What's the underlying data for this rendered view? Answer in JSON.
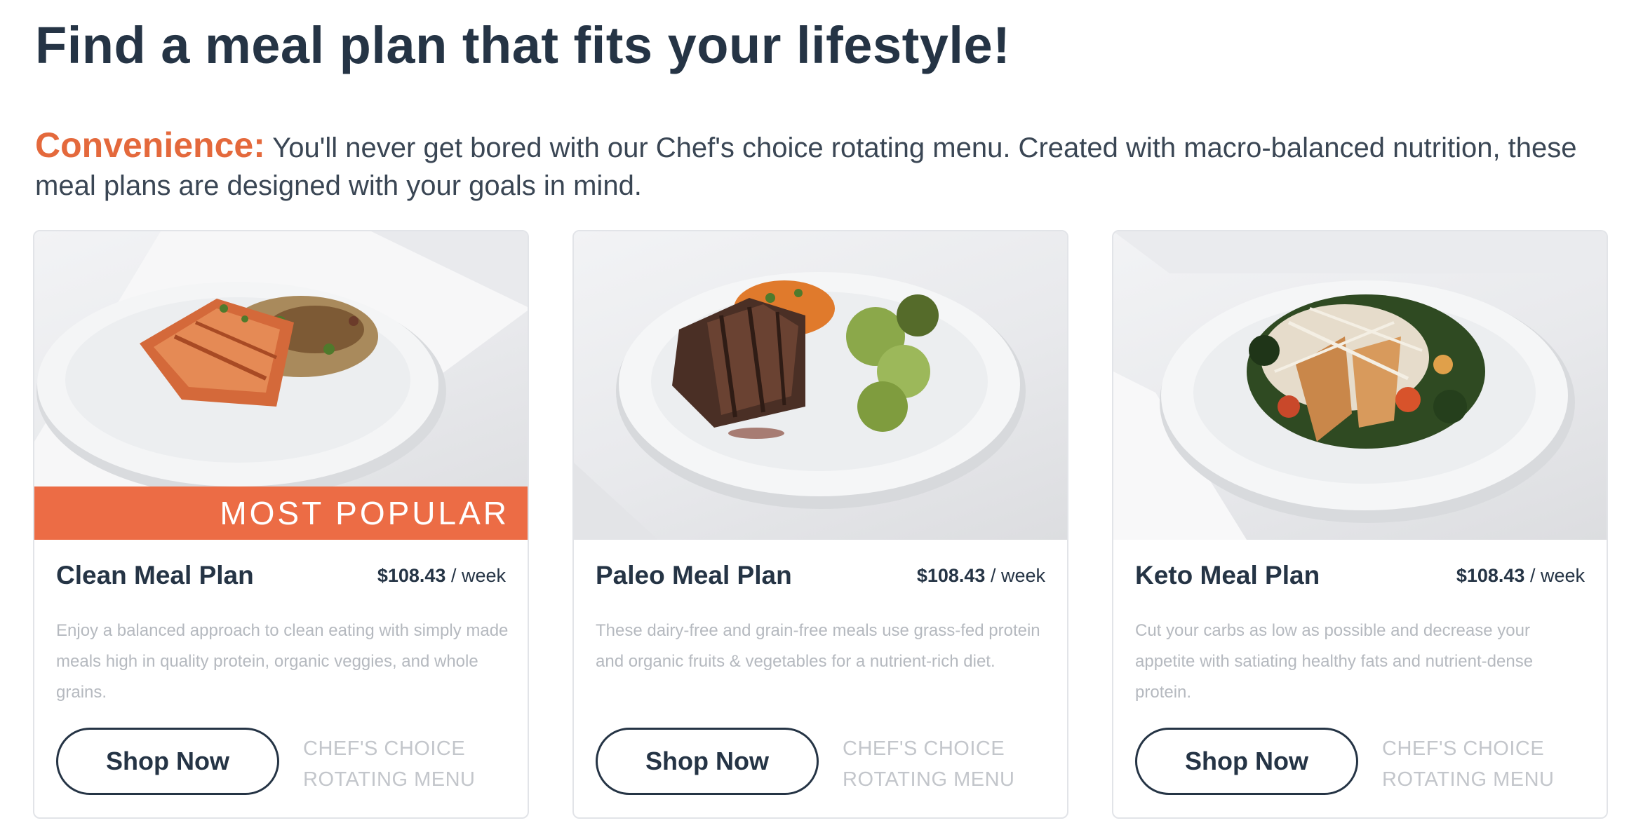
{
  "page": {
    "title": "Find a meal plan that fits your lifestyle!",
    "intro_highlight": "Convenience:",
    "intro_text": " You'll never get bored with our Chef's choice rotating menu. Created with macro-balanced nutrition, these meal plans are designed with your goals in mind."
  },
  "colors": {
    "heading": "#253445",
    "accent": "#e4693c",
    "ribbon": "#ec6c45",
    "muted_text": "#b5b9bf"
  },
  "cards": [
    {
      "image": "salmon-plate-image",
      "ribbon": "MOST POPULAR",
      "name": "Clean Meal Plan",
      "price": "$108.43",
      "price_unit": " / week",
      "description": "Enjoy a balanced approach to clean eating with simply made meals high in quality protein, organic veggies, and whole grains.",
      "button": "Shop Now",
      "note": "CHEF'S CHOICE ROTATING MENU"
    },
    {
      "image": "steak-plate-image",
      "name": "Paleo Meal Plan",
      "price": "$108.43",
      "price_unit": " / week",
      "description": "These dairy-free and grain-free meals use grass-fed protein and organic fruits & vegetables for a nutrient-rich diet.",
      "button": "Shop Now",
      "note": "CHEF'S CHOICE ROTATING MENU"
    },
    {
      "image": "keto-salad-plate-image",
      "name": "Keto Meal Plan",
      "price": "$108.43",
      "price_unit": " / week",
      "description": "Cut your carbs as low as possible and decrease your appetite with satiating healthy fats and nutrient-dense protein.",
      "button": "Shop Now",
      "note": "CHEF'S CHOICE ROTATING MENU"
    }
  ]
}
